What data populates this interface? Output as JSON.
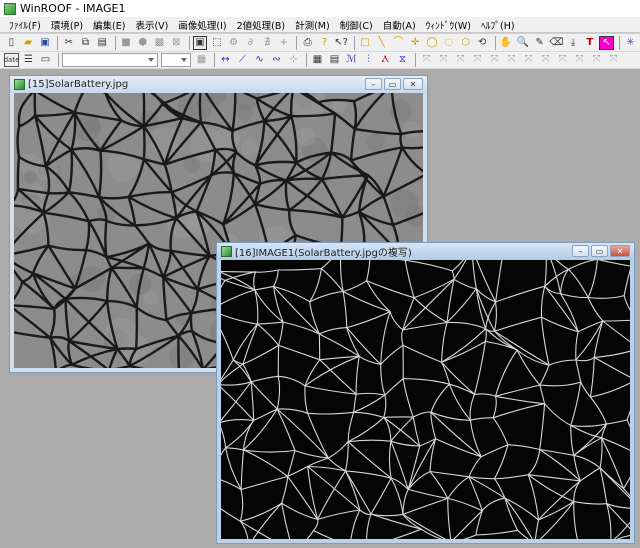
{
  "app": {
    "title": "WinROOF - IMAGE1"
  },
  "menu": {
    "items": [
      "ﾌｧｲﾙ(F)",
      "環境(P)",
      "編集(E)",
      "表示(V)",
      "画像処理(I)",
      "2値処理(B)",
      "計測(M)",
      "制御(C)",
      "自動(A)",
      "ｳｨﾝﾄﾞｳ(W)",
      "ﾍﾙﾌﾟ(H)"
    ]
  },
  "windows": {
    "original": {
      "title": "[15]SolarBattery.jpg"
    },
    "processed": {
      "title": "[16]IMAGE1(SolarBattery.jpgの複写)"
    }
  },
  "colors": {
    "mdi_background": "#ababab",
    "window_frame": "#cfe0f1",
    "selected_tool": "#ff00cc"
  }
}
